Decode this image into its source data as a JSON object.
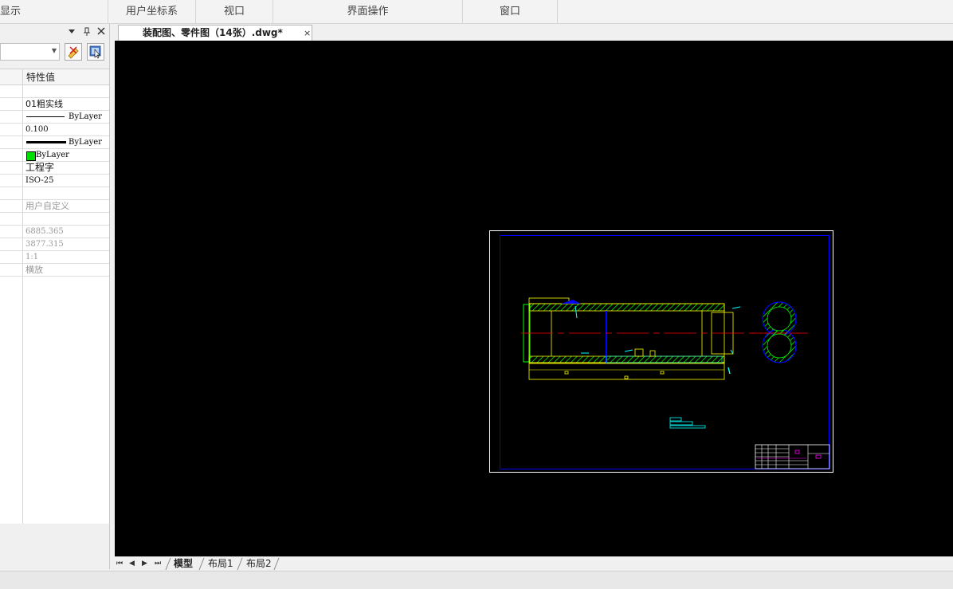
{
  "ribbon": {
    "groups": [
      "显示",
      "用户坐标系",
      "视口",
      "界面操作",
      "窗口"
    ]
  },
  "properties_panel": {
    "title_buttons": {
      "dropdown": "▼",
      "pin": "ᵖ",
      "close": "✕"
    },
    "column_header": "特性值",
    "rows": {
      "layer": "01粗实线",
      "linetype": "ByLayer",
      "linetype_scale": "0.100",
      "lineweight": "ByLayer",
      "color": "ByLayer",
      "text_style": "工程字",
      "dim_style": "ISO-25",
      "paper_size": "用户自定义",
      "width": "6885.365",
      "height": "3877.315",
      "scale": "1:1",
      "orientation": "横放"
    },
    "colors": {
      "color_swatch": "#00e000"
    }
  },
  "document_tab": {
    "title": "装配图、零件图（14张）.dwg*",
    "close": "×"
  },
  "layout_tabs": {
    "nav": [
      "⏮",
      "◀",
      "▶",
      "⏭"
    ],
    "tabs": [
      "模型",
      "布局1",
      "布局2"
    ],
    "active": "模型"
  },
  "canvas": {
    "background": "#000000",
    "colors": {
      "frame": "#ffffff",
      "border": "#0000ff",
      "part": "#ffff00",
      "hatch": "#00ff00",
      "centerline": "#ff0000",
      "section": "#00ffff",
      "magenta": "#ff00ff"
    }
  }
}
